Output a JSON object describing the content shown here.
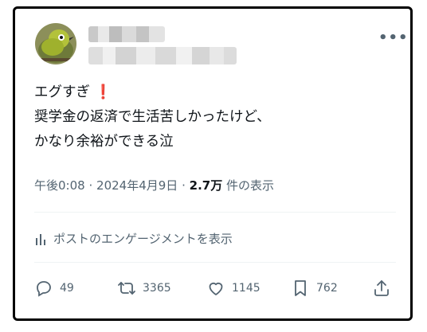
{
  "post": {
    "more_icon": "more-horizontal-icon",
    "body_lines": [
      "エグすぎ",
      "奨学金の返済で生活苦しかったけど、",
      "かなり余裕ができる泣"
    ],
    "emoji": "❗",
    "time": "午後0:08",
    "sep": "·",
    "date": "2024年4月9日",
    "views_count": "2.7万",
    "views_label": "件の表示",
    "engagement_label": "ポストのエンゲージメントを表示",
    "replies": "49",
    "reposts": "3365",
    "likes": "1145",
    "bookmarks": "762"
  },
  "colors": {
    "text": "#0f1419",
    "muted": "#536471",
    "divider": "#eff3f4",
    "emoji_red": "#dd2e44"
  }
}
